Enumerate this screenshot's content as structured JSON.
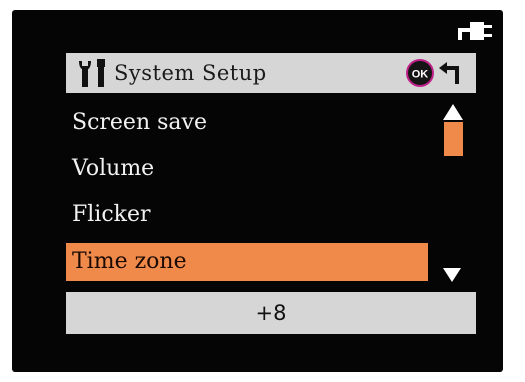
{
  "header": {
    "title": "System Setup"
  },
  "menu": {
    "items": [
      {
        "label": "Screen save"
      },
      {
        "label": "Volume"
      },
      {
        "label": "Flicker"
      },
      {
        "label": "Time zone",
        "selected": true
      }
    ]
  },
  "value": {
    "text": "+8"
  },
  "icons": {
    "power": "power-plug-icon",
    "tools": "tools-icon",
    "ok": "ok-button-icon",
    "back": "back-arrow-icon",
    "scroll_up": "scroll-up-arrow-icon",
    "scroll_down": "scroll-down-arrow-icon"
  },
  "colors": {
    "accent": "#f08a4b",
    "panel": "#d6d6d6",
    "background": "#050505"
  }
}
